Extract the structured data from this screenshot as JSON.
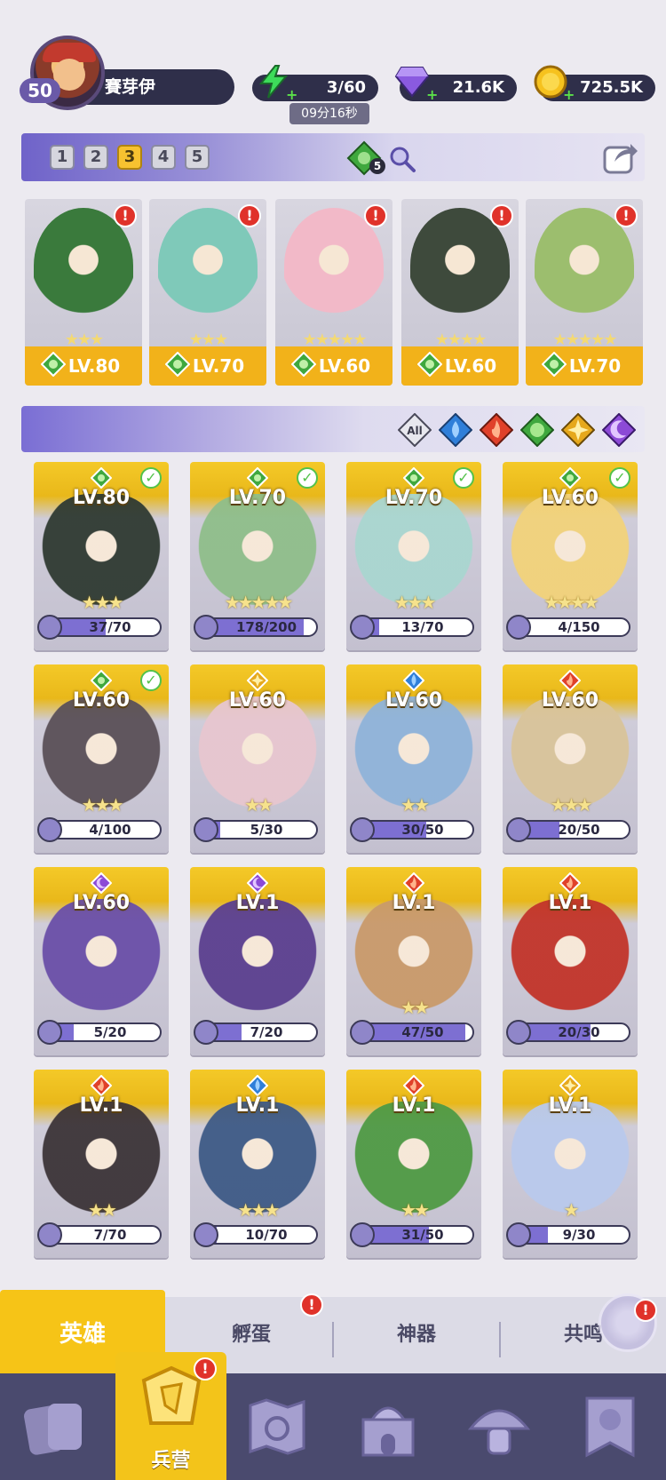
{
  "player": {
    "level": "50",
    "name": "賽芽伊"
  },
  "resources": {
    "energy": "3/60",
    "energy_timer": "09分16秒",
    "gems": "21.6K",
    "coins": "725.5K"
  },
  "team_bar": {
    "tabs": [
      "1",
      "2",
      "3",
      "4",
      "5"
    ],
    "active_tab": "3",
    "element_count": "5"
  },
  "team": [
    {
      "level": "LV.80",
      "stars": "★★★",
      "color": "#3a7a3c"
    },
    {
      "level": "LV.70",
      "stars": "★★★",
      "color": "#7fc9b9"
    },
    {
      "level": "LV.60",
      "stars": "★★★★★",
      "color": "#f2b9c8"
    },
    {
      "level": "LV.60",
      "stars": "★★★★",
      "color": "#3e4a3c"
    },
    {
      "level": "LV.70",
      "stars": "★★★★★",
      "color": "#9cbe6e"
    }
  ],
  "filters": [
    "All",
    "water",
    "fire",
    "nature",
    "light",
    "dark"
  ],
  "heroes": [
    {
      "level": "LV.80",
      "element": "nature",
      "checked": true,
      "progress": "37/70",
      "frac": 0.53,
      "stars": "★★★",
      "art": "#2f3a32"
    },
    {
      "level": "LV.70",
      "element": "nature",
      "checked": true,
      "progress": "178/200",
      "frac": 0.89,
      "stars": "★★★★★",
      "art": "#8fbe8a"
    },
    {
      "level": "LV.70",
      "element": "nature",
      "checked": true,
      "progress": "13/70",
      "frac": 0.19,
      "stars": "★★★",
      "art": "#a9d6d0"
    },
    {
      "level": "LV.60",
      "element": "nature",
      "checked": true,
      "progress": "4/150",
      "frac": 0.03,
      "stars": "★★★★",
      "art": "#f2d27a"
    },
    {
      "level": "LV.60",
      "element": "nature",
      "checked": true,
      "progress": "4/100",
      "frac": 0.04,
      "stars": "★★★",
      "art": "#5a5058"
    },
    {
      "level": "LV.60",
      "element": "light",
      "checked": false,
      "progress": "5/30",
      "frac": 0.17,
      "stars": "★★",
      "art": "#e7c6cf"
    },
    {
      "level": "LV.60",
      "element": "water",
      "checked": false,
      "progress": "30/50",
      "frac": 0.6,
      "stars": "★★",
      "art": "#8fb3d9"
    },
    {
      "level": "LV.60",
      "element": "fire",
      "checked": false,
      "progress": "20/50",
      "frac": 0.4,
      "stars": "★★★",
      "art": "#d9c49a"
    },
    {
      "level": "LV.60",
      "element": "dark",
      "checked": false,
      "progress": "5/20",
      "frac": 0.25,
      "stars": "",
      "art": "#6a4fa8"
    },
    {
      "level": "LV.1",
      "element": "dark",
      "checked": false,
      "progress": "7/20",
      "frac": 0.35,
      "stars": "",
      "art": "#5b3f8f"
    },
    {
      "level": "LV.1",
      "element": "fire",
      "checked": false,
      "progress": "47/50",
      "frac": 0.94,
      "stars": "★★",
      "art": "#c99a6a"
    },
    {
      "level": "LV.1",
      "element": "fire",
      "checked": false,
      "progress": "20/30",
      "frac": 0.67,
      "stars": "",
      "art": "#c2342a"
    },
    {
      "level": "LV.1",
      "element": "fire",
      "checked": false,
      "progress": "7/70",
      "frac": 0.1,
      "stars": "★★",
      "art": "#3c3438"
    },
    {
      "level": "LV.1",
      "element": "water",
      "checked": false,
      "progress": "10/70",
      "frac": 0.14,
      "stars": "★★★",
      "art": "#3e5a86"
    },
    {
      "level": "LV.1",
      "element": "fire",
      "checked": false,
      "progress": "31/50",
      "frac": 0.62,
      "stars": "★★",
      "art": "#4f9a44"
    },
    {
      "level": "LV.1",
      "element": "light",
      "checked": false,
      "progress": "9/30",
      "frac": 0.3,
      "stars": "★",
      "art": "#b9c9ec"
    }
  ],
  "sub_tabs": [
    "英雄",
    "孵蛋",
    "神器",
    "共鸣"
  ],
  "nav": [
    "cards",
    "兵营",
    "map",
    "castle",
    "mushroom",
    "banner"
  ],
  "colors": {
    "nature": "#3fa83e",
    "water": "#2f7fd9",
    "fire": "#e0412a",
    "light": "#e6a81c",
    "dark": "#8c4ad6",
    "accent": "#f3c41a"
  }
}
